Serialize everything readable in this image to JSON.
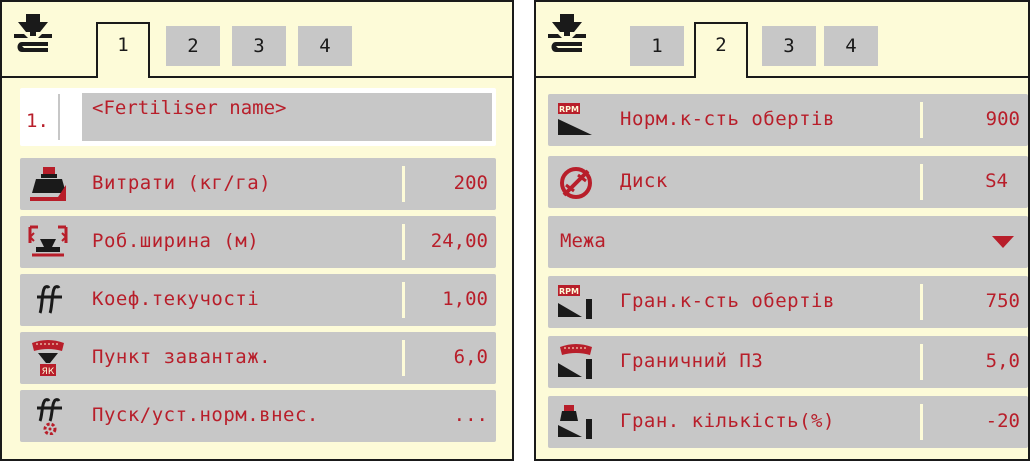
{
  "left_panel": {
    "tabs": [
      "1",
      "2",
      "3",
      "4"
    ],
    "active_tab": "1",
    "fertiliser": {
      "index": "1.",
      "name": "<Fertiliser name>"
    },
    "rows": [
      {
        "label": "Витрати (кг/га)",
        "value": "200",
        "icon": "application-rate-icon"
      },
      {
        "label": "Роб.ширина (м)",
        "value": "24,00",
        "icon": "working-width-icon"
      },
      {
        "label": "Коеф.текучості",
        "value": "1,00",
        "icon": "flow-factor-icon"
      },
      {
        "label": "Пункт завантаж.",
        "value": "6,0",
        "icon": "drop-point-icon"
      },
      {
        "label": "Пуск/уст.норм.внес.",
        "value": "...",
        "icon": "flow-factor-start-icon"
      }
    ]
  },
  "right_panel": {
    "tabs": [
      "1",
      "2",
      "3",
      "4"
    ],
    "active_tab": "2",
    "rows": [
      {
        "label": "Норм.к-сть обертів",
        "value": "900",
        "icon": "normal-rpm-icon"
      },
      {
        "label": "Диск",
        "value": "S4",
        "icon": "spreading-disc-icon"
      },
      {
        "label": "Межа",
        "value": "",
        "icon": "dropdown-caret-icon"
      },
      {
        "label": "Гран.к-сть обертів",
        "value": "750",
        "icon": "border-rpm-icon"
      },
      {
        "label": "Граничний ПЗ",
        "value": "5,0",
        "icon": "border-drop-point-icon"
      },
      {
        "label": "Гран. кількість(%)",
        "value": "-20",
        "icon": "border-quantity-icon"
      }
    ]
  },
  "icon_text": {
    "rpm": "RPM",
    "yak": "ЯК"
  },
  "colors": {
    "panel_bg": "#fdfbd8",
    "row_bg": "#c7c7c7",
    "text_red": "#b81e2a",
    "icon_dark": "#1a1a1a"
  }
}
